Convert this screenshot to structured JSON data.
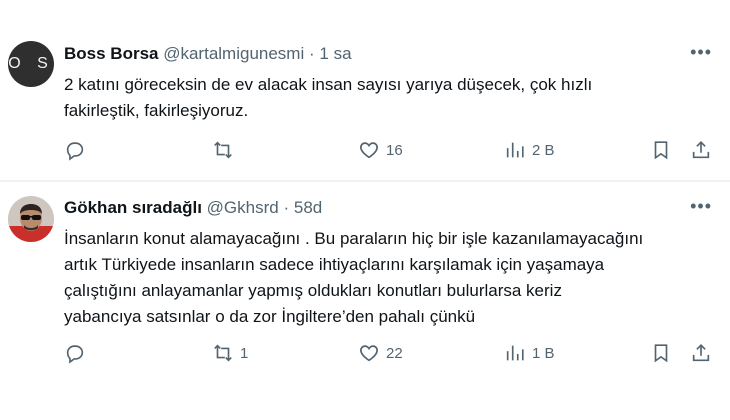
{
  "tweets": [
    {
      "avatar_text": "O S",
      "name": "Boss Borsa",
      "handle": "@kartalmigunesmi",
      "sep": "·",
      "time": "1 sa",
      "text_lines": [
        "2 katını göreceksin de ev alacak insan sayısı yarıya düşecek, çok hızlı",
        "fakirleştik, fakirleşiyoruz."
      ],
      "replies": "",
      "retweets": "",
      "likes": "16",
      "views": "2 B"
    },
    {
      "name": "Gökhan sıradağlı",
      "handle": "@Gkhsrd",
      "sep": "·",
      "time": "58d",
      "text_lines": [
        "İnsanların konut alamayacağını . Bu paraların hiç bir işle kazanılamayacağını",
        "artık Türkiyede insanların sadece ihtiyaçlarını karşılamak için yaşamaya",
        "çalıştığını anlayamanlar yapmış oldukları konutları bulurlarsa keriz",
        "yabancıya satsınlar o da zor İngiltere’den pahalı çünkü"
      ],
      "replies": "",
      "retweets": "1",
      "likes": "22",
      "views": "1 B"
    }
  ],
  "icons": [
    "reply-icon",
    "retweet-icon",
    "like-icon",
    "views-icon",
    "bookmark-icon",
    "share-icon",
    "more-icon"
  ]
}
